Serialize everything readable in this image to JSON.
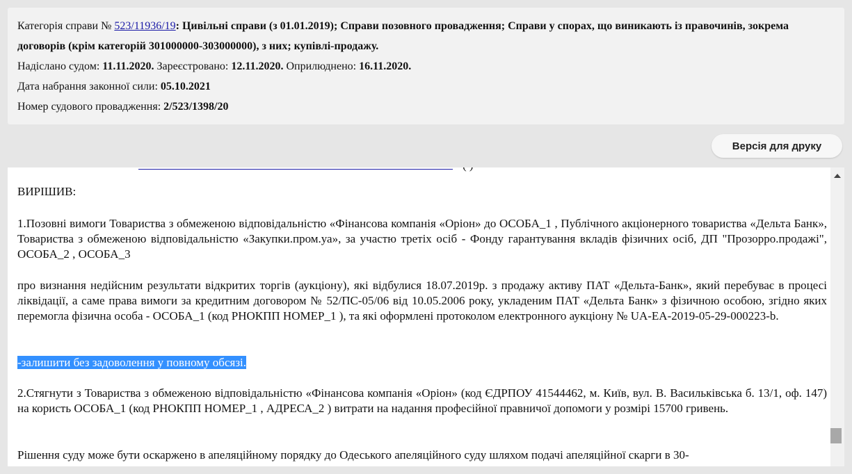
{
  "info": {
    "category_prefix": "Категорія справи № ",
    "case_link": "523/11936/19",
    "category_bold": ": Цивільні справи (з 01.01.2019); Справи позовного провадження; Справи у спорах, що виникають із правочинів, зокрема договорів (крім категорій 301000000-303000000), з них; купівлі-продажу.",
    "sent_label": "Надіслано судом: ",
    "sent_date": "11.11.2020.",
    "registered_label": " Зареєстровано: ",
    "registered_date": "12.11.2020.",
    "published_label": " Оприлюднено: ",
    "published_date": "16.11.2020.",
    "effective_label": "Дата набрання законної сили: ",
    "effective_date": "05.10.2021",
    "proceeding_label": "Номер судового провадження: ",
    "proceeding_number": "2/523/1398/20"
  },
  "toolbar": {
    "print_label": "Версія для друку"
  },
  "document": {
    "cut_dot": "-",
    "cut_tail": "( )",
    "decided": "ВИРІШИВ:",
    "p1": "1.Позовні вимоги Товариства з обмеженою відповідальністю «Фінансова компанія «Оріон» до ОСОБА_1 , Публічного акціонерного товариства «Дельта Банк», Товариства з обмеженою відповідальністю «Закупки.пром.уа», за участю третіх осіб - Фонду гарантування вкладів фізичних осіб, ДП \"Прозорро.продажі\", ОСОБА_2 , ОСОБА_3",
    "p2": "про визнання недійсним результати відкритих торгів (аукціону), які відбулися 18.07.2019р. з продажу активу ПАТ «Дельта-Банк», який перебуває в процесі ліквідації, а саме права вимоги за кредитним договором № 52/ПС-05/06 від 10.05.2006 року, укладеним ПАТ «Дельта Банк» з фізичною особою, згідно яких перемогла фізична особа - ОСОБА_1 (код РНОКПП НОМЕР_1 ), та які оформлені протоколом електронного аукціону № UA-EA-2019-05-29-000223-b.",
    "p3_selected": "-залишити без задоволення у повному обсязі.",
    "p4": "2.Стягнути з Товариства з обмеженою відповідальністю «Фінансова компанія «Оріон» (код ЄДРПОУ 41544462, м. Київ, вул. В. Васильківська б. 13/1, оф. 147) на користь ОСОБА_1 (код РНОКПП НОМЕР_1 , АДРЕСА_2 ) витрати на надання професійної правничої допомоги у розмірі 15700 гривень.",
    "p5": "Рішення суду може бути оскаржено в апеляційному порядку до Одеського апеляційного суду шляхом подачі апеляційної скарги в 30-"
  },
  "colors": {
    "link": "#1a1aa6",
    "selection": "#3390ff",
    "background": "#e6e6e6",
    "card": "#f2f2f2"
  }
}
